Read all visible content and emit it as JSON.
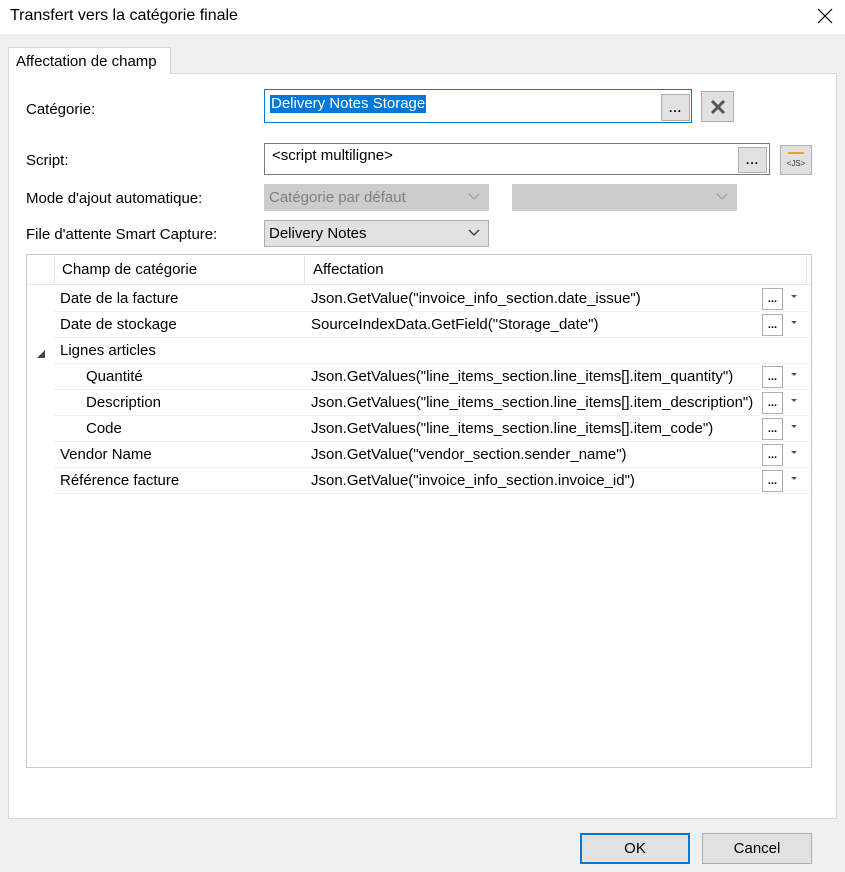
{
  "window": {
    "title": "Transfert vers la catégorie finale",
    "close_icon": "close-icon"
  },
  "tab": {
    "label": "Affectation de champ"
  },
  "form": {
    "category": {
      "label": "Catégorie:",
      "value": "Delivery Notes Storage",
      "browse_label": "...",
      "clear_icon": "x-icon"
    },
    "script": {
      "label": "Script:",
      "value": "<script multiligne>",
      "browse_label": "...",
      "js_icon": "js-script-icon"
    },
    "auto_mode": {
      "label": "Mode d'ajout automatique:",
      "value": "Catégorie par défaut",
      "second_value": ""
    },
    "smart_queue": {
      "label": "File d'attente Smart Capture:",
      "value": "Delivery Notes"
    }
  },
  "grid": {
    "columns": [
      "Champ de catégorie",
      "Affectation"
    ],
    "rows": [
      {
        "field": "Date de la facture",
        "value": "Json.GetValue(\"invoice_info_section.date_issue\")",
        "indent": false,
        "group": false
      },
      {
        "field": "Date de stockage",
        "value": "SourceIndexData.GetField(\"Storage_date\")",
        "indent": false,
        "group": false
      },
      {
        "field": "Lignes articles",
        "value": "",
        "indent": false,
        "group": true
      },
      {
        "field": "Quantité",
        "value": "Json.GetValues(\"line_items_section.line_items[].item_quantity\")",
        "indent": true,
        "group": false
      },
      {
        "field": "Description",
        "value": "Json.GetValues(\"line_items_section.line_items[].item_description\")",
        "indent": true,
        "group": false
      },
      {
        "field": "Code",
        "value": "Json.GetValues(\"line_items_section.line_items[].item_code\")",
        "indent": true,
        "group": false
      },
      {
        "field": "Vendor Name",
        "value": "Json.GetValue(\"vendor_section.sender_name\")",
        "indent": false,
        "group": false
      },
      {
        "field": "Référence facture",
        "value": "Json.GetValue(\"invoice_info_section.invoice_id\")",
        "indent": false,
        "group": false
      }
    ],
    "row_button_label": "..."
  },
  "buttons": {
    "ok": "OK",
    "cancel": "Cancel"
  },
  "colors": {
    "accent": "#0078d7",
    "window_bg": "#f0f0f0",
    "button_bg": "#e1e1e1",
    "disabled_bg": "#cccccc",
    "js_icon": "#e8a317"
  }
}
